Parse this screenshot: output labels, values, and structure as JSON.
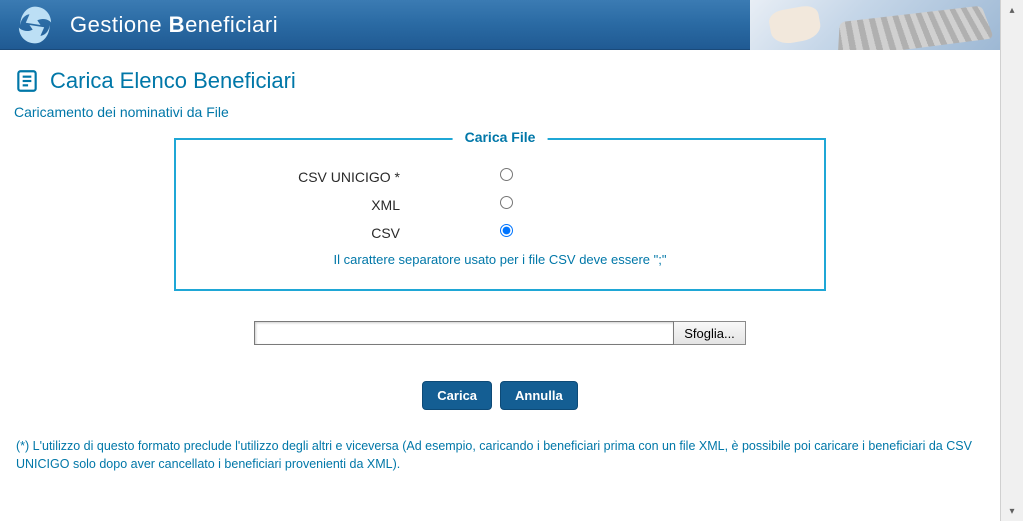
{
  "header": {
    "title_prefix": "Gestione ",
    "title_strong": "B",
    "title_rest": "eneficiari"
  },
  "page": {
    "title": "Carica Elenco Beneficiari",
    "subtitle": "Caricamento dei nominativi da File"
  },
  "fieldset": {
    "legend": "Carica File",
    "options": [
      {
        "label": "CSV UNICIGO *",
        "checked": false
      },
      {
        "label": "XML",
        "checked": false
      },
      {
        "label": "CSV",
        "checked": true
      }
    ],
    "note": "Il carattere separatore usato per i file CSV deve essere \";\""
  },
  "file": {
    "value": "",
    "browse_label": "Sfoglia..."
  },
  "actions": {
    "load": "Carica",
    "cancel": "Annulla"
  },
  "footnote": "(*) L'utilizzo di questo formato preclude l'utilizzo degli altri e viceversa (Ad esempio, caricando i beneficiari prima con un file XML, è possibile poi caricare i beneficiari da CSV UNICIGO solo dopo aver cancellato i beneficiari provenienti da XML)."
}
